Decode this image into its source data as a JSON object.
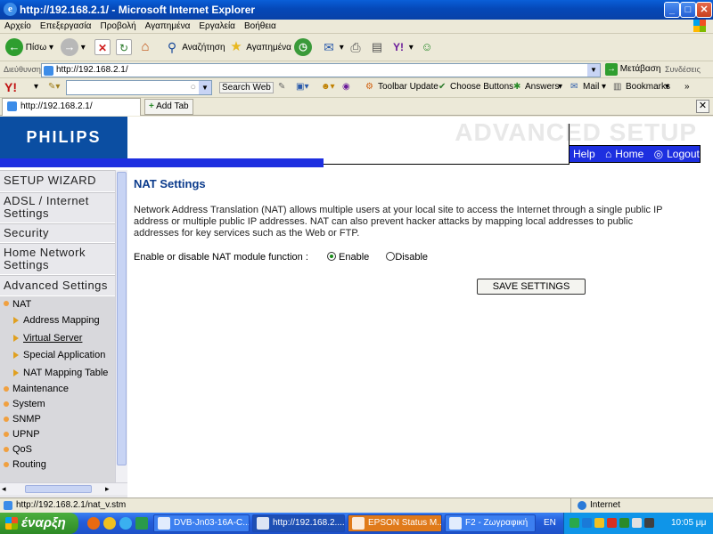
{
  "window": {
    "title": "http://192.168.2.1/ - Microsoft Internet Explorer",
    "min_label": "_",
    "max_label": "□",
    "close_label": "✕"
  },
  "menu": [
    "Αρχείο",
    "Επεξεργασία",
    "Προβολή",
    "Αγαπημένα",
    "Εργαλεία",
    "Βοήθεια"
  ],
  "toolbar": {
    "back_label": "Πίσω",
    "search_label": "Αναζήτηση",
    "favorites_label": "Αγαπημένα"
  },
  "address": {
    "label": "Διεύθυνση",
    "value": "http://192.168.2.1/",
    "go_label": "Μετάβαση",
    "links_label": "Συνδέσεις"
  },
  "yahoo": {
    "logo": "Y!",
    "search_web_label": "Search Web",
    "toolbar_update_label": "Toolbar Update",
    "choose_buttons_label": "Choose Buttons",
    "answers_label": "Answers",
    "mail_label": "Mail",
    "bookmarks_label": "Bookmarks"
  },
  "tabs": {
    "current_tab": "http://192.168.2.1/",
    "add_tab_label": "Add Tab"
  },
  "router": {
    "brand": "PHILIPS",
    "header_title": "ADVANCED SETUP",
    "help_label": "Help",
    "home_label": "Home",
    "logout_label": "Logout"
  },
  "sidebar": {
    "sections": [
      "SETUP WIZARD",
      "ADSL / Internet Settings",
      "Security",
      "Home Network Settings",
      "Advanced Settings"
    ],
    "nat_label": "NAT",
    "nat_items": [
      "Address Mapping",
      "Virtual Server",
      "Special Application",
      "NAT Mapping Table"
    ],
    "other_items": [
      "Maintenance",
      "System",
      "SNMP",
      "UPNP",
      "QoS",
      "Routing"
    ]
  },
  "content": {
    "title": "NAT Settings",
    "description": "Network Address Translation (NAT) allows multiple users at your local site to access the Internet through a single public IP address or multiple public IP addresses. NAT can also prevent hacker attacks by mapping local addresses to public addresses for key services such as the Web or FTP.",
    "nat_function_label": "Enable or disable NAT module function :",
    "enable_label": "Enable",
    "disable_label": "Disable",
    "nat_enabled": true,
    "save_label": "SAVE SETTINGS"
  },
  "status": {
    "url": "http://192.168.2.1/nat_v.stm",
    "zone": "Internet"
  },
  "taskbar": {
    "start_label": "έναρξη",
    "tasks": [
      "DVB-Jn03-16A-C...",
      "http://192.168.2....",
      "EPSON Status M...",
      "F2 - Ζωγραφική"
    ],
    "lang": "EN",
    "clock": "10:05 μμ"
  }
}
